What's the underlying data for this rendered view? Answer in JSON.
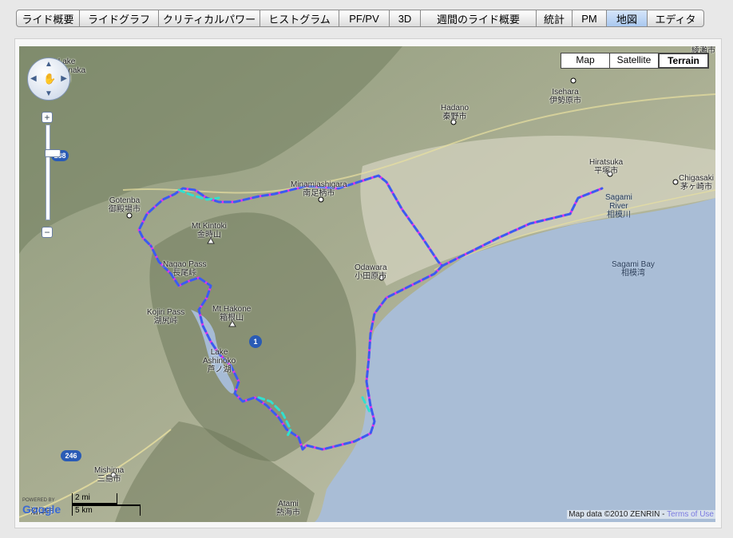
{
  "tabs": [
    {
      "label": "ライド概要",
      "w": 78
    },
    {
      "label": "ライドグラフ",
      "w": 98
    },
    {
      "label": "クリティカルパワー",
      "w": 126
    },
    {
      "label": "ヒストグラム",
      "w": 98
    },
    {
      "label": "PF/PV",
      "w": 62
    },
    {
      "label": "3D",
      "w": 38
    },
    {
      "label": "週間のライド概要",
      "w": 144
    },
    {
      "label": "統計",
      "w": 44
    },
    {
      "label": "PM",
      "w": 42
    },
    {
      "label": "地図",
      "w": 50
    },
    {
      "label": "エディタ",
      "w": 70
    }
  ],
  "active_tab": "地図",
  "map_type": {
    "map": "Map",
    "satellite": "Satellite",
    "terrain": "Terrain",
    "selected": "Terrain"
  },
  "zoom": {
    "plus": "+",
    "minus": "−"
  },
  "places": [
    {
      "id": "lake-yamanaka",
      "line1": "Lake",
      "line2": "Yamanaka",
      "line3": "湖"
    },
    {
      "id": "gotenba",
      "line1": "Gotenba",
      "line2": "御殿場市"
    },
    {
      "id": "minamiashigara",
      "line1": "Minamiashigara",
      "line2": "南足柄市"
    },
    {
      "id": "hadano",
      "line1": "Hadano",
      "line2": "秦野市"
    },
    {
      "id": "isehara",
      "line1": "Isehara",
      "line2": "伊勢原市"
    },
    {
      "id": "hiratsuka",
      "line1": "Hiratsuka",
      "line2": "平塚市"
    },
    {
      "id": "chigasaki",
      "line1": "Chigasaki",
      "line2": "茅ヶ崎市"
    },
    {
      "id": "sagami-river",
      "line1": "Sagami",
      "line2": "River",
      "line3": "相模川"
    },
    {
      "id": "sagami-bay",
      "line1": "Sagami Bay",
      "line2": "相模湾"
    },
    {
      "id": "mt-kintoki",
      "line1": "Mt Kintoki",
      "line2": "金時山"
    },
    {
      "id": "nagao-pass",
      "line1": "Nagao Pass",
      "line2": "長尾峠"
    },
    {
      "id": "odawara",
      "line1": "Odawara",
      "line2": "小田原市"
    },
    {
      "id": "kojiri-pass",
      "line1": "Kojiri Pass",
      "line2": "湖尻峠"
    },
    {
      "id": "mt-hakone",
      "line1": "Mt Hakone",
      "line2": "箱根山"
    },
    {
      "id": "lake-ashinoko",
      "line1": "Lake",
      "line2": "Ashinoko",
      "line3": "芦ノ湖"
    },
    {
      "id": "mishima",
      "line1": "Mishima",
      "line2": "三島市"
    },
    {
      "id": "atami",
      "line1": "Atami",
      "line2": "熱海市"
    },
    {
      "id": "numazu",
      "line1": "沼津市"
    },
    {
      "id": "ayase",
      "line1": "綾瀬市"
    }
  ],
  "shields": {
    "r138": "138",
    "r1": "1",
    "r246": "246"
  },
  "scale": {
    "miles": "2 mi",
    "km": "5 km"
  },
  "logo": {
    "powered": "POWERED BY",
    "name": "Google"
  },
  "copyright": {
    "text": "Map data ©2010 ZENRIN - ",
    "link": "Terms of Use"
  },
  "colors": {
    "route_magenta": "#e830e8",
    "route_blue": "#3a5cf0",
    "route_cyan": "#30e0d0",
    "sea": "#a9bdd6"
  }
}
